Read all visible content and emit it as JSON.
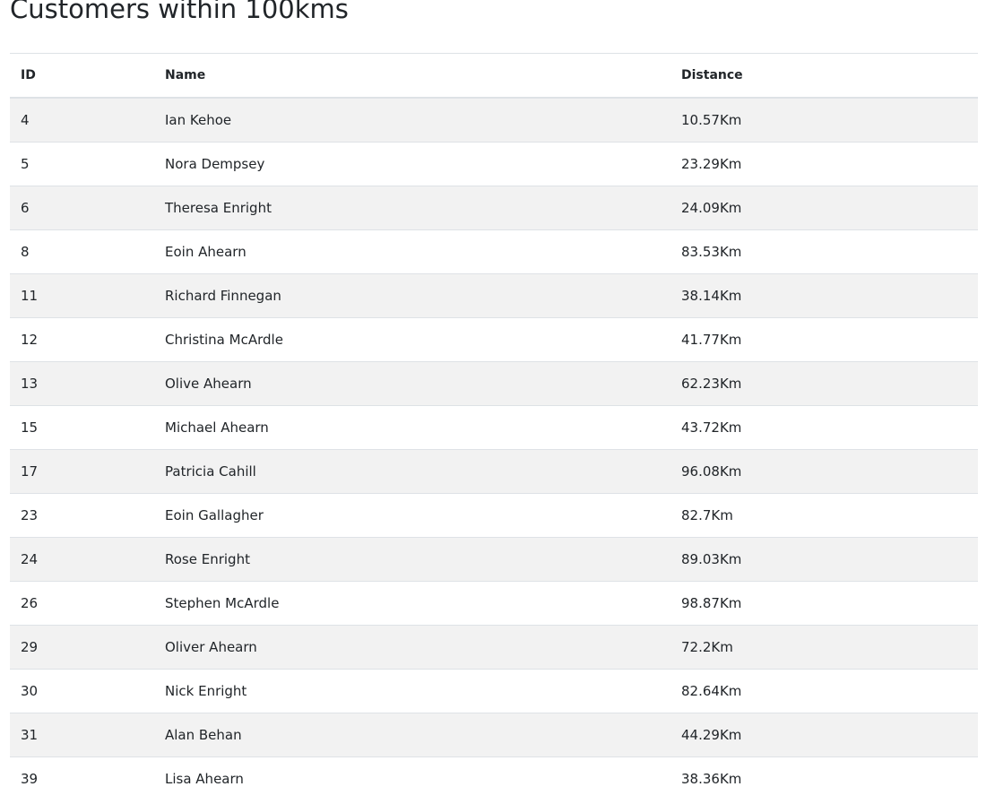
{
  "page": {
    "title": "Customers within 100kms"
  },
  "table": {
    "headers": {
      "id": "ID",
      "name": "Name",
      "distance": "Distance"
    },
    "rows": [
      {
        "id": "4",
        "name": "Ian Kehoe",
        "distance": "10.57Km"
      },
      {
        "id": "5",
        "name": "Nora Dempsey",
        "distance": "23.29Km"
      },
      {
        "id": "6",
        "name": "Theresa Enright",
        "distance": "24.09Km"
      },
      {
        "id": "8",
        "name": "Eoin Ahearn",
        "distance": "83.53Km"
      },
      {
        "id": "11",
        "name": "Richard Finnegan",
        "distance": "38.14Km"
      },
      {
        "id": "12",
        "name": "Christina McArdle",
        "distance": "41.77Km"
      },
      {
        "id": "13",
        "name": "Olive Ahearn",
        "distance": "62.23Km"
      },
      {
        "id": "15",
        "name": "Michael Ahearn",
        "distance": "43.72Km"
      },
      {
        "id": "17",
        "name": "Patricia Cahill",
        "distance": "96.08Km"
      },
      {
        "id": "23",
        "name": "Eoin Gallagher",
        "distance": "82.7Km"
      },
      {
        "id": "24",
        "name": "Rose Enright",
        "distance": "89.03Km"
      },
      {
        "id": "26",
        "name": "Stephen McArdle",
        "distance": "98.87Km"
      },
      {
        "id": "29",
        "name": "Oliver Ahearn",
        "distance": "72.2Km"
      },
      {
        "id": "30",
        "name": "Nick Enright",
        "distance": "82.64Km"
      },
      {
        "id": "31",
        "name": "Alan Behan",
        "distance": "44.29Km"
      },
      {
        "id": "39",
        "name": "Lisa Ahearn",
        "distance": "38.36Km"
      }
    ]
  },
  "colors": {
    "text": "#212529",
    "stripe": "#f2f2f2",
    "border": "#dee2e6"
  }
}
